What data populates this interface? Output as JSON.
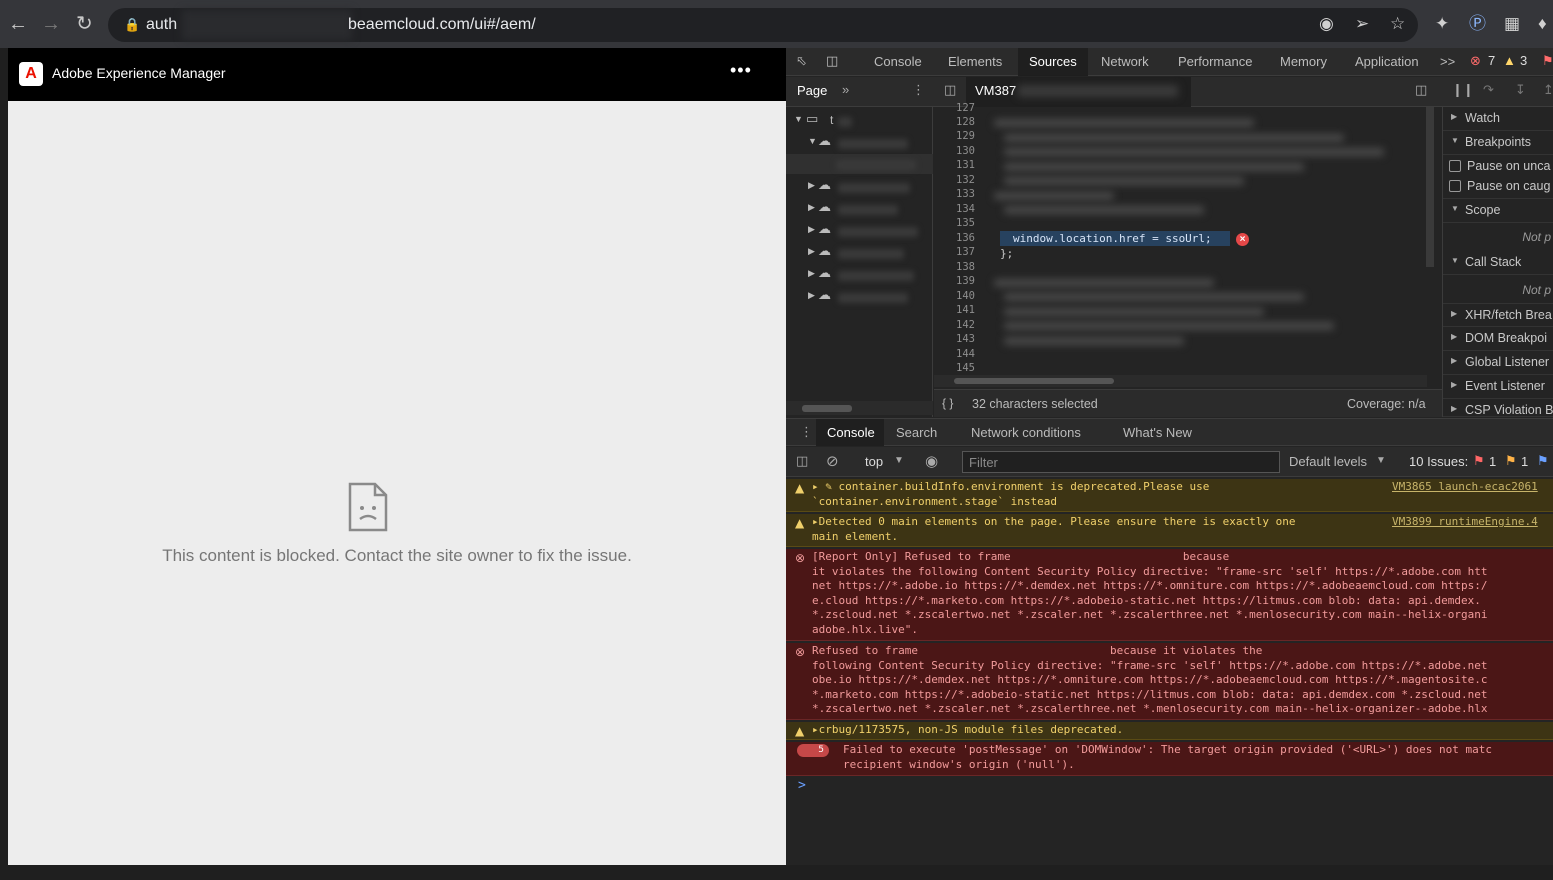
{
  "browser": {
    "url_prefix": "auth",
    "url_suffix": "beaemcloud.com/ui#/aem/"
  },
  "aem": {
    "app_title": "Adobe Experience Manager",
    "logo_letter": "A",
    "more": "•••",
    "blocked_message": "This content is blocked. Contact the site owner to fix the issue."
  },
  "devtools": {
    "tabs": [
      "Console",
      "Elements",
      "Sources",
      "Network",
      "Performance",
      "Memory",
      "Application"
    ],
    "active_tab": "Sources",
    "overflow": ">>",
    "error_count": "7",
    "warning_count": "3",
    "sources": {
      "page_tab": "Page",
      "file_tab": "VM387",
      "tree_first_label": "t",
      "line_numbers": [
        "127",
        "128",
        "129",
        "130",
        "131",
        "132",
        "133",
        "134",
        "135",
        "136",
        "137",
        "138",
        "139",
        "140",
        "141",
        "142",
        "143",
        "144",
        "145"
      ],
      "highlighted_code": "window.location.href = ssoUrl;",
      "closing_code": "};",
      "status_selection": "32 characters selected",
      "status_coverage": "Coverage: n/a",
      "brace_icon": "{ }"
    },
    "debugger": {
      "sections": [
        {
          "label": "Watch",
          "open": false
        },
        {
          "label": "Breakpoints",
          "open": true
        },
        {
          "label": "Pause on unca",
          "checkbox": true
        },
        {
          "label": "Pause on caug",
          "checkbox": true
        },
        {
          "label": "Scope",
          "open": true
        },
        {
          "label": "Not p",
          "note": true
        },
        {
          "label": "Call Stack",
          "open": true
        },
        {
          "label": "Not p",
          "note": true
        },
        {
          "label": "XHR/fetch Brea",
          "open": false
        },
        {
          "label": "DOM Breakpoi",
          "open": false
        },
        {
          "label": "Global Listener",
          "open": false
        },
        {
          "label": "Event Listener",
          "open": false
        },
        {
          "label": "CSP Violation B",
          "open": false
        }
      ]
    },
    "drawer": {
      "tabs": [
        "Console",
        "Search",
        "Network conditions",
        "What's New"
      ],
      "active": "Console",
      "context": "top",
      "filter_placeholder": "Filter",
      "levels": "Default levels",
      "issues_label": "10 Issues:",
      "issue_counts": [
        "1",
        "1"
      ]
    },
    "console_messages": [
      {
        "level": "warning",
        "lines": [
          "▸ ✎ container.buildInfo.environment is deprecated.Please use",
          "`container.environment.stage` instead"
        ],
        "source": "VM3865 launch-ecac2061"
      },
      {
        "level": "warning",
        "lines": [
          "▸Detected 0 main elements on the page. Please ensure there is exactly one",
          "main element."
        ],
        "source": "VM3899 runtimeEngine.4"
      },
      {
        "level": "error",
        "lines": [
          "[Report Only] Refused to frame                          because",
          "it violates the following Content Security Policy directive: \"frame-src 'self' https://*.adobe.com htt",
          "net https://*.adobe.io https://*.demdex.net https://*.omniture.com https://*.adobeaemcloud.com https:/",
          "e.cloud https://*.marketo.com https://*.adobeio-static.net https://litmus.com blob: data: api.demdex.",
          "*.zscloud.net *.zscalertwo.net *.zscaler.net *.zscalerthree.net *.menlosecurity.com main--helix-organi",
          "adobe.hlx.live\"."
        ]
      },
      {
        "level": "error",
        "lines": [
          "Refused to frame                             because it violates the",
          "following Content Security Policy directive: \"frame-src 'self' https://*.adobe.com https://*.adobe.net",
          "obe.io https://*.demdex.net https://*.omniture.com https://*.adobeaemcloud.com https://*.magentosite.c",
          "*.marketo.com https://*.adobeio-static.net https://litmus.com blob: data: api.demdex.com *.zscloud.net",
          "*.zscalertwo.net *.zscaler.net *.zscalerthree.net *.menlosecurity.com main--helix-organizer--adobe.hlx"
        ]
      },
      {
        "level": "warning",
        "lines": [
          "▸crbug/1173575, non-JS module files deprecated."
        ]
      },
      {
        "level": "error",
        "badge": "5",
        "lines": [
          "Failed to execute 'postMessage' on 'DOMWindow': The target origin provided ('<URL>') does not matc",
          "recipient window's origin ('null')."
        ]
      }
    ],
    "prompt": ">"
  },
  "colors": {
    "adobe_red": "#eb1000",
    "devtools_bg": "#242424",
    "warning_bg": "#3d3414",
    "error_bg": "#4b1616",
    "link_blue": "#6aa0ff"
  },
  "icons": [
    "back-icon",
    "forward-icon",
    "reload-icon",
    "lock-icon",
    "eye-icon",
    "share-icon",
    "star-icon",
    "extension-icon",
    "blocked-page-icon",
    "inspect-icon",
    "device-icon",
    "error-icon",
    "warning-icon"
  ]
}
